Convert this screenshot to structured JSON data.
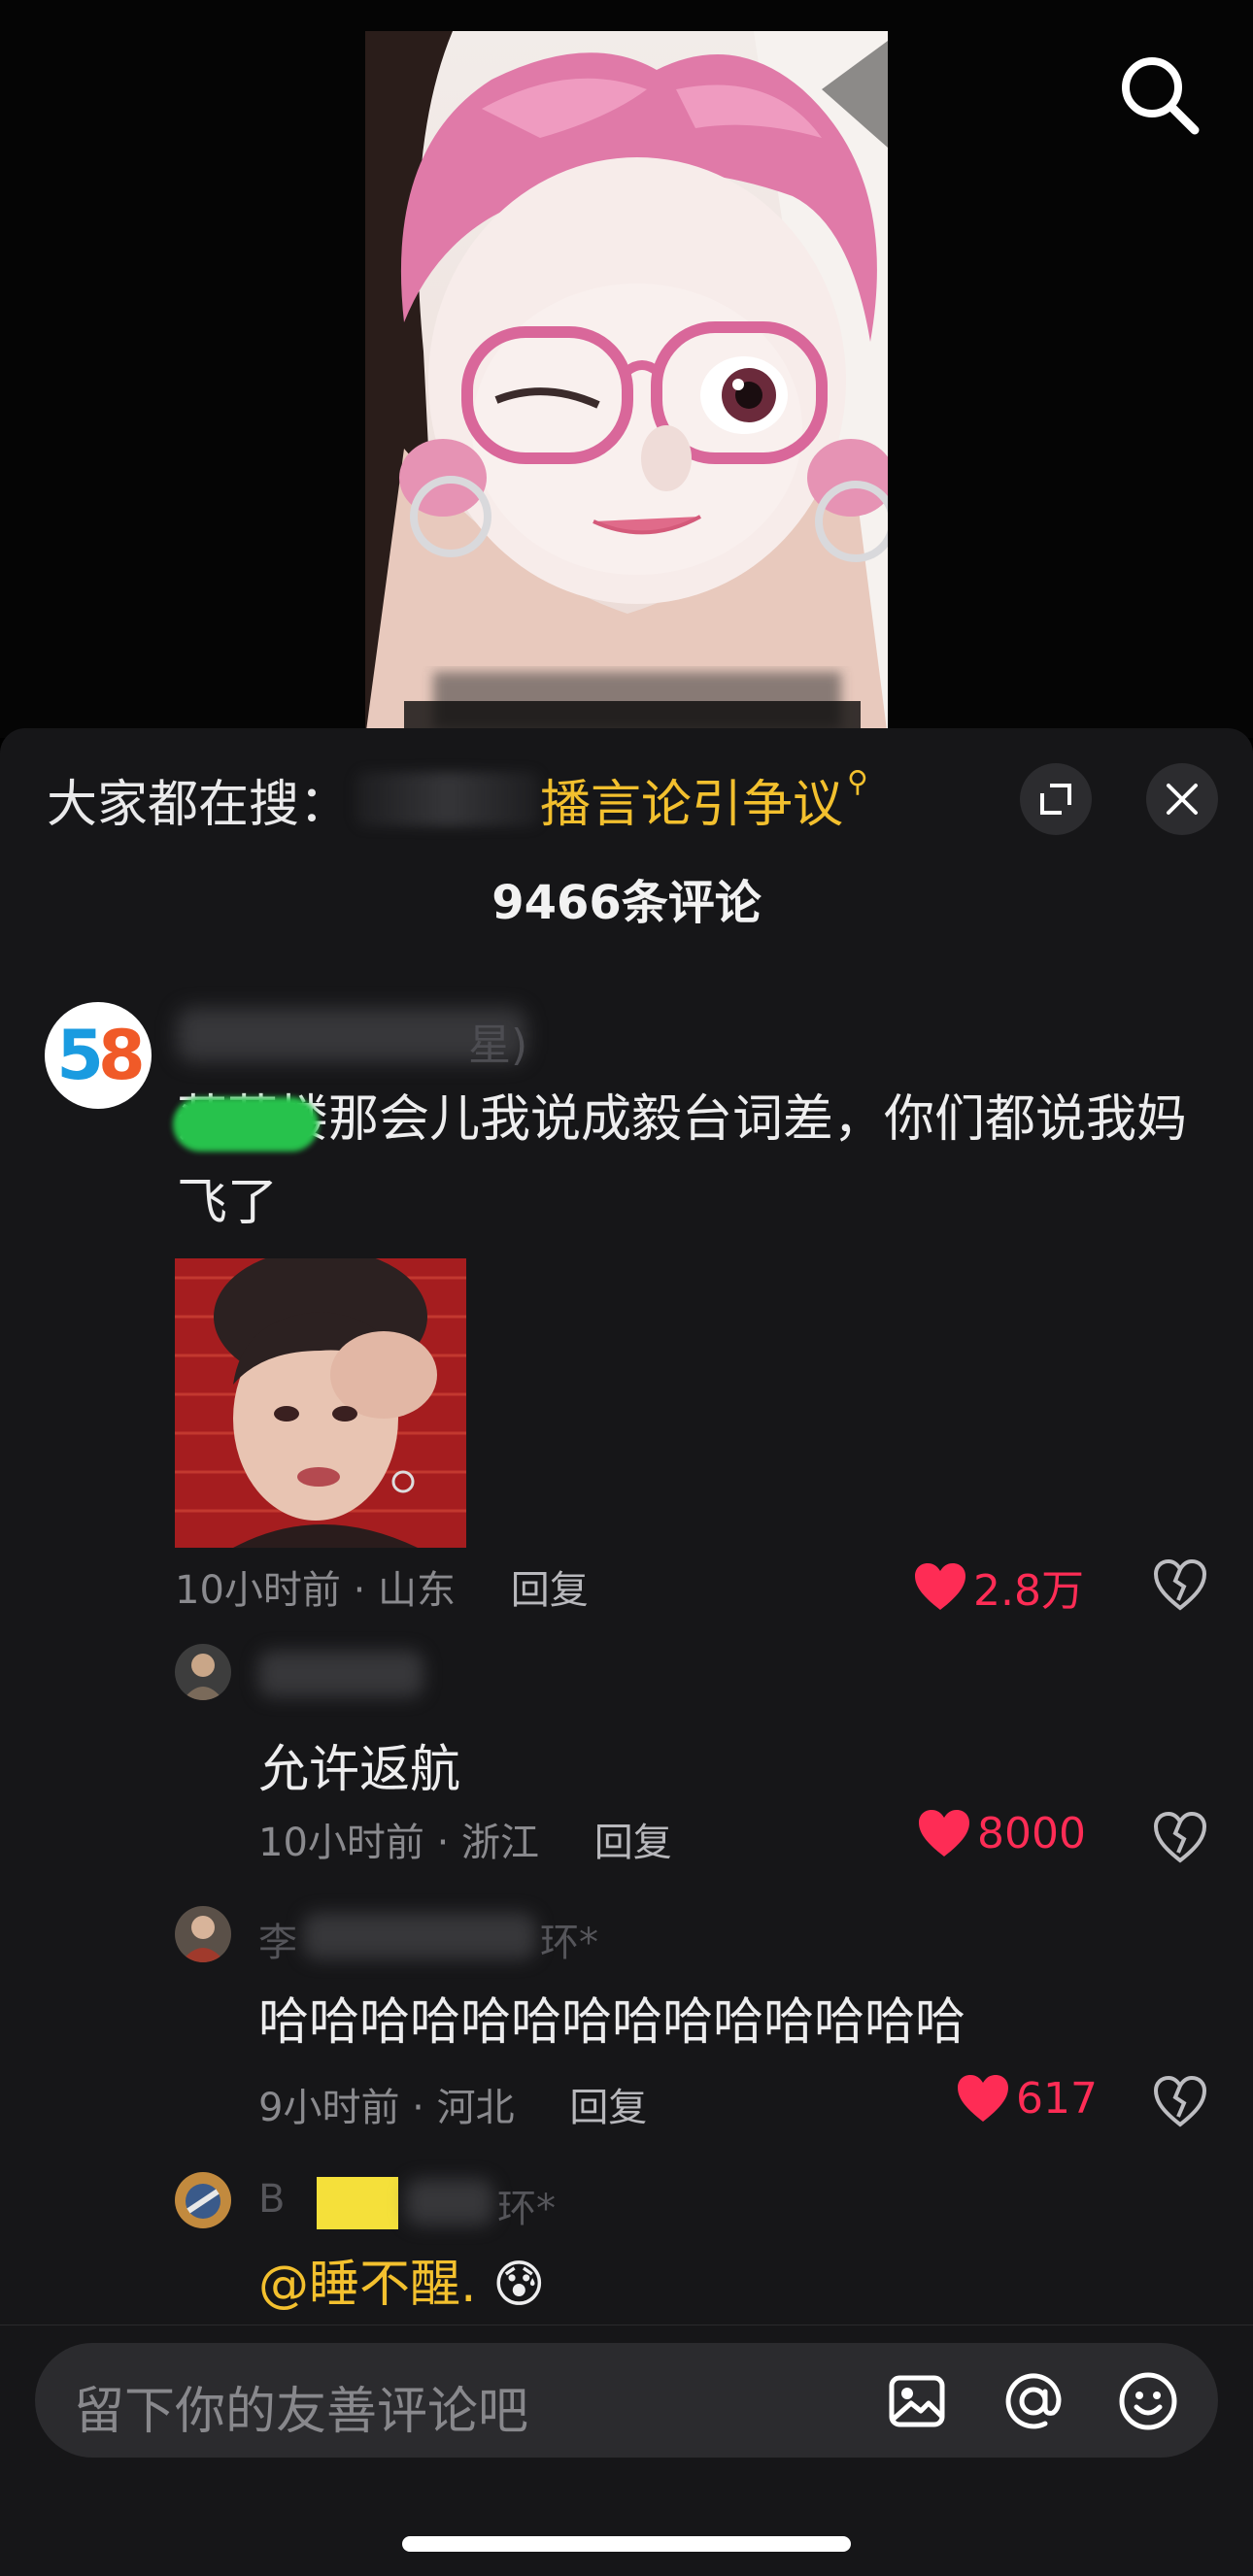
{
  "hot_search": {
    "prefix": "大家都在搜：",
    "topic": "播言论引争议"
  },
  "comment_count": "9466条评论",
  "comments": [
    {
      "name_tail": "星)",
      "text": "落菲楼那会儿我说成毅台词差，你们都说我妈飞了",
      "time_location": "10小时前 · 山东",
      "reply_label": "回复",
      "likes": "2.8万",
      "replies": [
        {
          "text": "允许返航",
          "time_location": "10小时前 · 浙江",
          "reply_label": "回复",
          "likes": "8000"
        },
        {
          "name_prefix": "李",
          "name_tail": "环*",
          "text": "哈哈哈哈哈哈哈哈哈哈哈哈哈哈",
          "time_location": "9小时前 · 河北",
          "reply_label": "回复",
          "likes": "617"
        },
        {
          "name_prefix": "B",
          "name_tail": "环*",
          "text_mention": "@睡不醒.",
          "emoji": "😰"
        }
      ]
    }
  ],
  "input": {
    "placeholder": "留下你的友善评论吧"
  },
  "icons": [
    "search-icon",
    "expand-icon",
    "close-icon",
    "heart-icon",
    "broken-heart-icon",
    "image-icon",
    "at-icon",
    "emoji-icon"
  ],
  "colors": {
    "accent_yellow": "#f3c02e",
    "like_red": "#fe2c55",
    "sheet_bg": "#161618"
  }
}
